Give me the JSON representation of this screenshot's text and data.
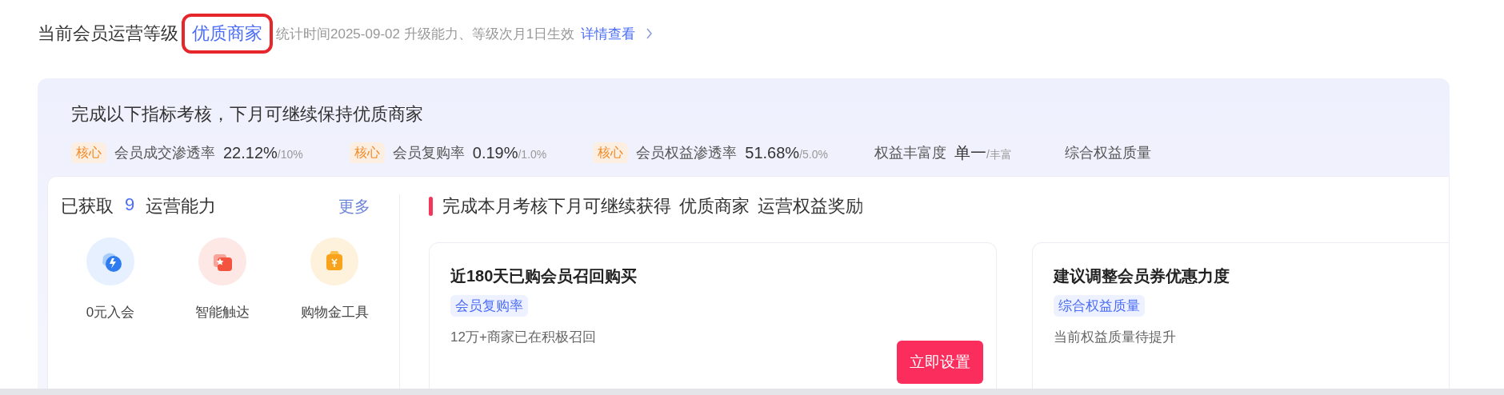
{
  "header": {
    "label": "当前会员运营等级",
    "level_name": "优质商家",
    "highlighted": true,
    "note": "统计时间2025-09-02 升级能力、等级次月1日生效",
    "link": "详情查看"
  },
  "assessment": {
    "title": "完成以下指标考核，下月可继续保持优质商家",
    "metrics": [
      {
        "badge": "核心",
        "name": "会员成交渗透率",
        "value": "22.12%",
        "target": "/10%"
      },
      {
        "badge": "核心",
        "name": "会员复购率",
        "value": "0.19%",
        "target": "/1.0%"
      },
      {
        "badge": "核心",
        "name": "会员权益渗透率",
        "value": "51.68%",
        "target": "/5.0%"
      },
      {
        "name": "权益丰富度",
        "value": "单一",
        "target": "/丰富"
      },
      {
        "name": "综合权益质量"
      }
    ]
  },
  "abilities": {
    "prefix": "已获取",
    "count": "9",
    "suffix": "运营能力",
    "more": "更多",
    "items": [
      {
        "label": "0元入会"
      },
      {
        "label": "智能触达"
      },
      {
        "label": "购物金工具"
      }
    ]
  },
  "rewards": {
    "prefix": "完成本月考核下月可继续获得",
    "level_name": "优质商家",
    "suffix": "运营权益奖励",
    "cards": [
      {
        "title": "近180天已购会员召回购买",
        "tag": "会员复购率",
        "desc": "12万+商家已在积极召回",
        "button": "立即设置"
      },
      {
        "title": "建议调整会员券优惠力度",
        "tag": "综合权益质量",
        "desc": "当前权益质量待提升"
      }
    ]
  }
}
